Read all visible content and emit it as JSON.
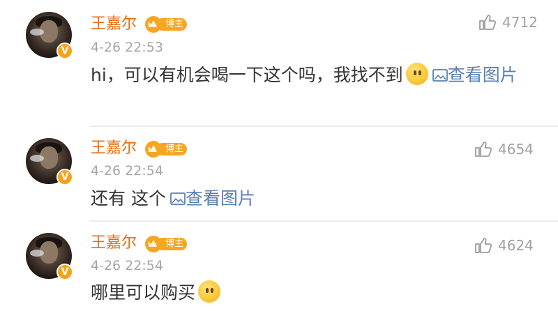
{
  "comments": [
    {
      "user": "王嘉尔",
      "badge": "博主",
      "time": "4-26 22:53",
      "likes": "4712",
      "text": "hi，可以有机会喝一下这个吗，我找不到",
      "link_label": "查看图片",
      "emoji": "smile-face-emoji"
    },
    {
      "user": "王嘉尔",
      "badge": "博主",
      "time": "4-26 22:54",
      "likes": "4654",
      "text": "还有 这个",
      "link_label": "查看图片"
    },
    {
      "user": "王嘉尔",
      "badge": "博主",
      "time": "4-26 22:54",
      "likes": "4624",
      "text": "哪里可以购买",
      "emoji": "smile-face-emoji"
    }
  ],
  "colors": {
    "username": "#e86b0f",
    "badge": "#f6a623",
    "timestamp": "#a6a6a6",
    "link": "#5b7fb5",
    "like_count": "#a0a0a0"
  },
  "icons": {
    "like": "thumbs-up-icon",
    "picture": "picture-icon",
    "verified": "verified-v-icon",
    "crown": "crown-icon"
  },
  "verified_mark": "V"
}
